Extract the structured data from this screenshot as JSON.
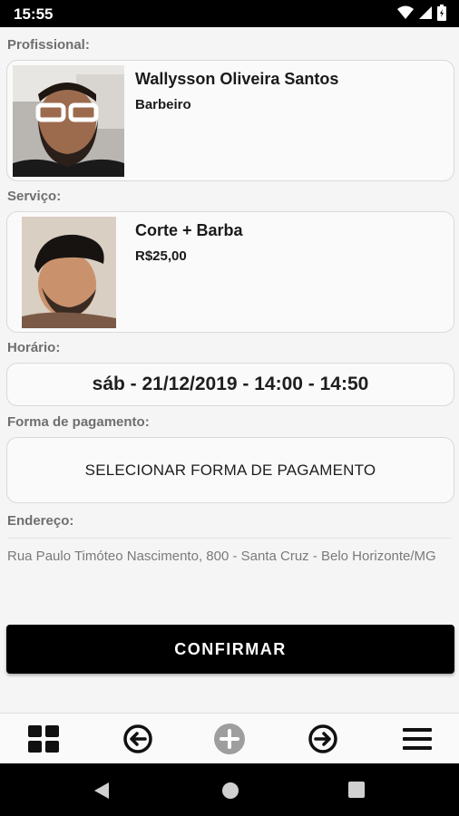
{
  "status_bar": {
    "time": "15:55",
    "icons": [
      "wifi-icon",
      "signal-icon",
      "battery-icon"
    ]
  },
  "professional": {
    "label": "Profissional:",
    "name": "Wallysson Oliveira Santos",
    "role": "Barbeiro"
  },
  "service": {
    "label": "Serviço:",
    "name": "Corte + Barba",
    "price": "R$25,00"
  },
  "schedule": {
    "label": "Horário:",
    "value": "sáb - 21/12/2019 - 14:00 - 14:50"
  },
  "payment": {
    "label": "Forma de pagamento:",
    "button_label": "SELECIONAR FORMA DE PAGAMENTO"
  },
  "address": {
    "label": "Endereço:",
    "value": "Rua Paulo Timóteo Nascimento, 800 - Santa Cruz - Belo Horizonte/MG"
  },
  "confirm_label": "CONFIRMAR",
  "bottom_nav": [
    "grid-icon",
    "arrow-left-circle-icon",
    "plus-circle-icon",
    "arrow-right-circle-icon",
    "menu-icon"
  ],
  "system_nav": [
    "back-icon",
    "home-icon",
    "recents-icon"
  ],
  "colors": {
    "accent": "#000000",
    "disabled": "#9e9e9e",
    "background": "#f5f5f5"
  }
}
